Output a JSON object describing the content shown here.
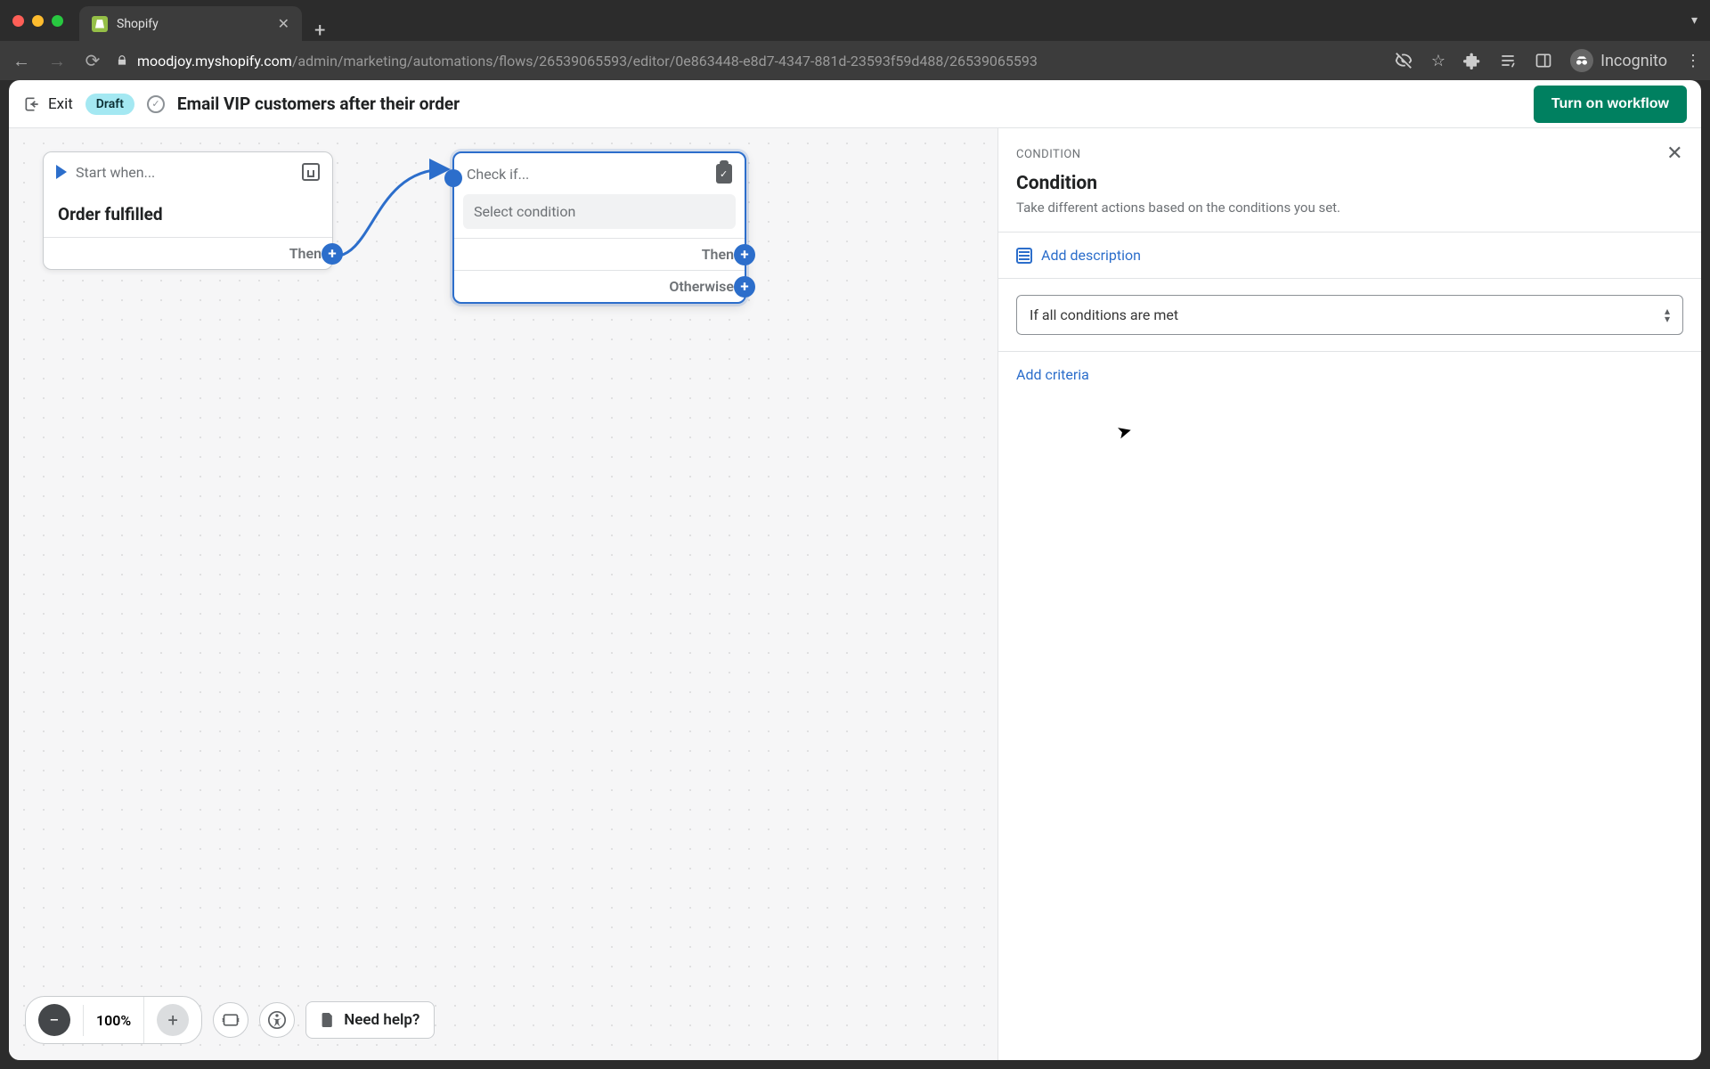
{
  "browser": {
    "tab_title": "Shopify",
    "url_host": "moodjoy.myshopify.com",
    "url_path": "/admin/marketing/automations/flows/26539065593/editor/0e863448-e8d7-4347-881d-23593f59d488/26539065593",
    "incognito_label": "Incognito"
  },
  "header": {
    "exit_label": "Exit",
    "status_badge": "Draft",
    "workflow_title": "Email VIP customers after their order",
    "primary_action": "Turn on workflow"
  },
  "canvas": {
    "start_node": {
      "title": "Start when...",
      "body": "Order fulfilled",
      "then_label": "Then"
    },
    "condition_node": {
      "title": "Check if...",
      "body": "Select condition",
      "then_label": "Then",
      "otherwise_label": "Otherwise"
    }
  },
  "toolbar": {
    "zoom_value": "100%",
    "help_label": "Need help?"
  },
  "sidepanel": {
    "kicker": "CONDITION",
    "title": "Condition",
    "subtitle": "Take different actions based on the conditions you set.",
    "add_description_label": "Add description",
    "match_select_value": "If all conditions are met",
    "add_criteria_label": "Add criteria"
  }
}
